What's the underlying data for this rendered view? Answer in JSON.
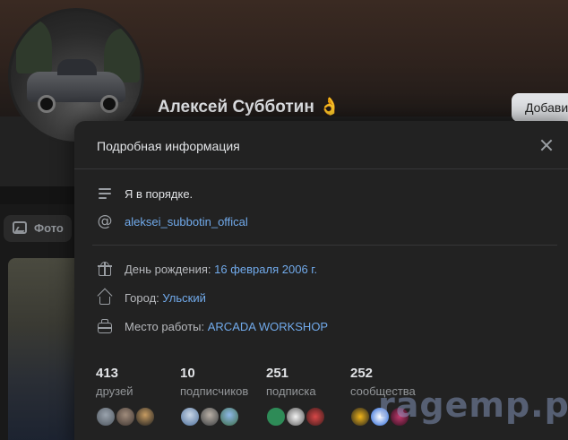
{
  "profile": {
    "name": "Алексей Субботин 👌",
    "add_button": "Добави",
    "photo_tab": "Фото"
  },
  "modal": {
    "title": "Подробная информация",
    "status": "Я в порядке.",
    "site": "aleksei_subbotin_offical",
    "birthday_label": "День рождения:",
    "birthday_value": "16 февраля 2006 г.",
    "city_label": "Город:",
    "city_value": "Ульский",
    "work_label": "Место работы:",
    "work_value": "ARCADA WORKSHOP"
  },
  "stats": [
    {
      "num": "413",
      "caption": "друзей"
    },
    {
      "num": "10",
      "caption": "подписчиков"
    },
    {
      "num": "251",
      "caption": "подписка"
    },
    {
      "num": "252",
      "caption": "сообщества"
    }
  ],
  "watermark": "ragemp.pro",
  "colors": {
    "accent_link": "#71aaeb",
    "modal_bg": "#222222",
    "page_bg": "#191919"
  },
  "icons": [
    "status-lines-icon",
    "at-icon",
    "gift-icon",
    "home-icon",
    "briefcase-icon",
    "close-icon",
    "photo-icon"
  ]
}
